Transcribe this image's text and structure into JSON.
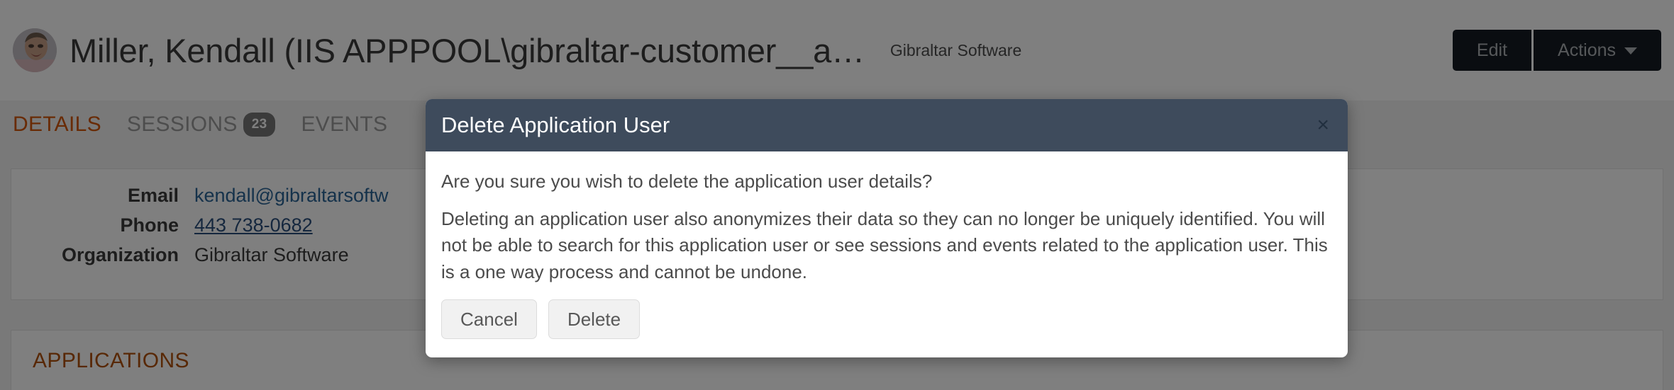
{
  "header": {
    "avatar_alt": "user-avatar",
    "title": "Miller, Kendall (IIS APPPOOL\\gibraltar-customer__a…",
    "subtitle": "Gibraltar Software",
    "edit_label": "Edit",
    "actions_label": "Actions"
  },
  "tabs": [
    {
      "label": "DETAILS",
      "badge": "",
      "active": true
    },
    {
      "label": "SESSIONS",
      "badge": "23",
      "active": false
    },
    {
      "label": "EVENTS",
      "badge": "",
      "active": false
    }
  ],
  "details": {
    "rows": [
      {
        "label": "Email",
        "value": "kendall@gibraltarsoftw",
        "style": "link"
      },
      {
        "label": "Phone",
        "value": "443 738-0682",
        "style": "link-underline"
      },
      {
        "label": "Organization",
        "value": "Gibraltar Software",
        "style": "plain"
      }
    ]
  },
  "applications_section": {
    "title": "APPLICATIONS"
  },
  "modal": {
    "title": "Delete Application User",
    "close_icon": "×",
    "paragraphs": [
      "Are you sure you wish to delete the application user details?",
      "Deleting an application user also anonymizes their data so they can no longer be uniquely identified. You will not be able to search for this application user or see sessions and events related to the application user. This is a one way process and cannot be undone."
    ],
    "cancel_label": "Cancel",
    "delete_label": "Delete"
  },
  "colors": {
    "accent_orange": "#d2560a",
    "section_orange": "#b0500a",
    "modal_header": "#3e4b5c",
    "dark_button": "#141b22",
    "link_blue": "#2a6496"
  }
}
